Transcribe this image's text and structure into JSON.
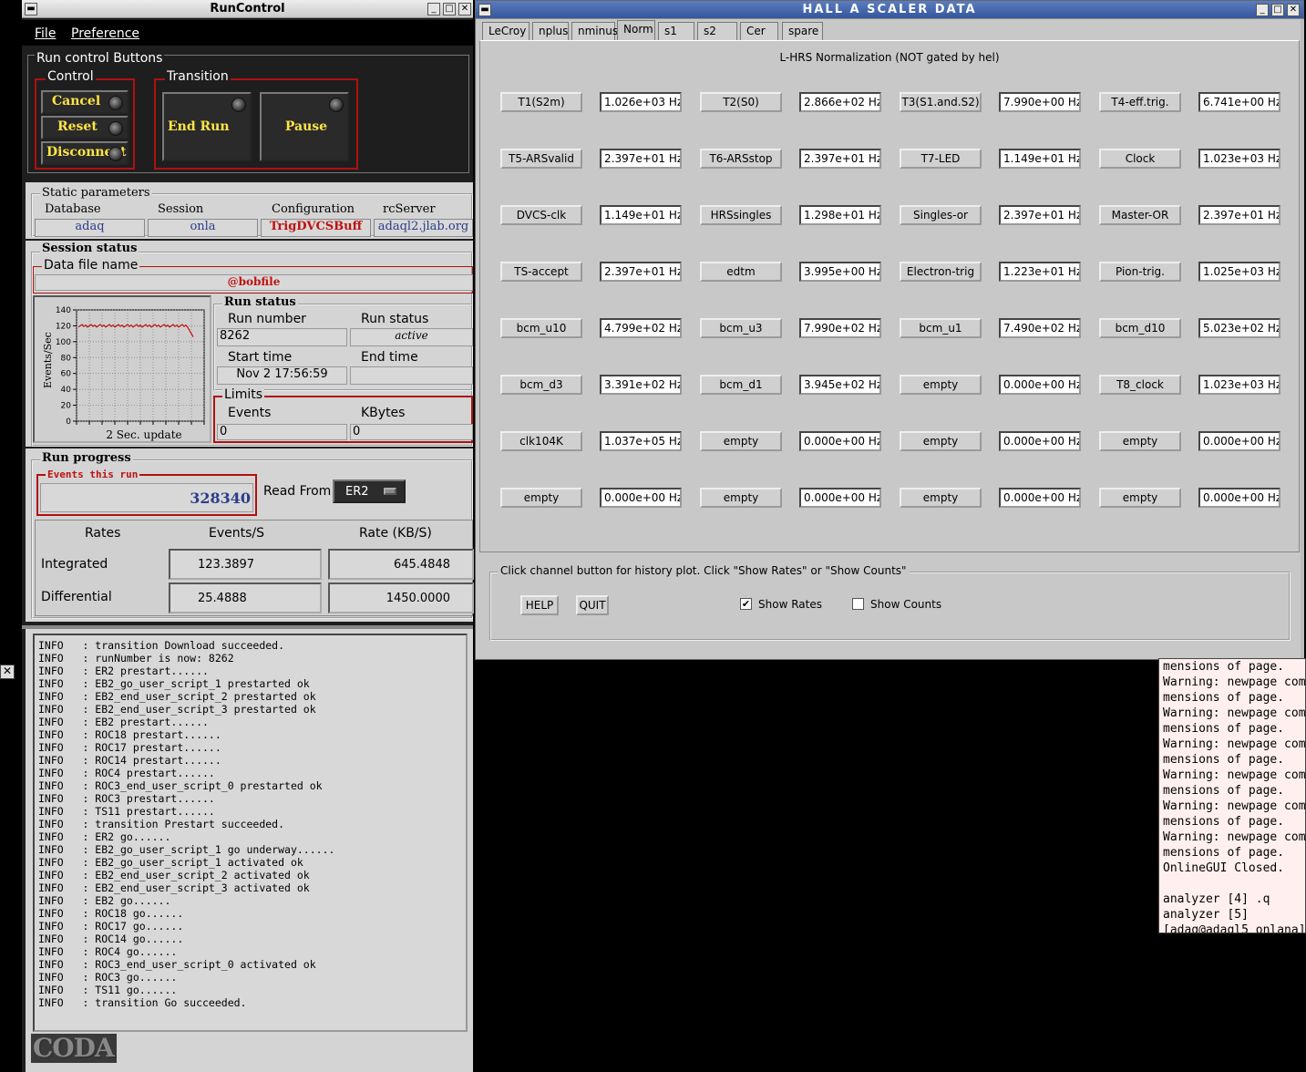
{
  "runcontrol": {
    "title": "RunControl",
    "menu": [
      "File",
      "Preference"
    ],
    "run_control_buttons_label": "Run control Buttons",
    "control_label": "Control",
    "transition_label": "Transition",
    "buttons": {
      "cancel": "Cancel",
      "reset": "Reset",
      "disconnect": "Disconnect",
      "end_run": "End Run",
      "pause": "Pause"
    },
    "static_params": {
      "label": "Static parameters",
      "database_label": "Database",
      "database": "adaq",
      "session_label": "Session",
      "session": "onla",
      "config_label": "Configuration",
      "config": "TrigDVCSBuff",
      "rcserver_label": "rcServer",
      "rcserver": "adaql2.jlab.org"
    },
    "session_status": {
      "label": "Session status",
      "datafile_label": "Data file name",
      "datafile": "@bobfile"
    },
    "plot": {
      "ylabel": "Events/Sec",
      "yticks": [
        "140",
        "120",
        "100",
        "80",
        "60",
        "40",
        "20",
        "0"
      ],
      "update_label": "2 Sec. update"
    },
    "run_status": {
      "label": "Run status",
      "run_number_label": "Run number",
      "run_number": "8262",
      "run_status_label": "Run status",
      "run_status": "active",
      "start_time_label": "Start time",
      "start_time": "Nov 2 17:56:59",
      "end_time_label": "End time",
      "end_time": ""
    },
    "limits": {
      "label": "Limits",
      "events_label": "Events",
      "events": "0",
      "kbytes_label": "KBytes",
      "kbytes": "0"
    },
    "run_progress": {
      "label": "Run progress",
      "events_label": "Events this run",
      "events": "328340",
      "read_from_label": "Read From:",
      "read_from": "ER2"
    },
    "rates": {
      "header": [
        "Rates",
        "Events/S",
        "Rate (KB/S)"
      ],
      "integrated_label": "Integrated",
      "integrated_events": "123.3897",
      "integrated_rate": "645.4848",
      "differential_label": "Differential",
      "differential_events": "25.4888",
      "differential_rate": "1450.0000"
    },
    "log": [
      "INFO   : transition Download succeeded.",
      "INFO   : runNumber is now: 8262",
      "INFO   : ER2 prestart......",
      "INFO   : EB2_go_user_script_1 prestarted ok",
      "INFO   : EB2_end_user_script_2 prestarted ok",
      "INFO   : EB2_end_user_script_3 prestarted ok",
      "INFO   : EB2 prestart......",
      "INFO   : ROC18 prestart......",
      "INFO   : ROC17 prestart......",
      "INFO   : ROC14 prestart......",
      "INFO   : ROC4 prestart......",
      "INFO   : ROC3_end_user_script_0 prestarted ok",
      "INFO   : ROC3 prestart......",
      "INFO   : TS11 prestart......",
      "INFO   : transition Prestart succeeded.",
      "INFO   : ER2 go......",
      "INFO   : EB2_go_user_script_1 go underway......",
      "INFO   : EB2_go_user_script_1 activated ok",
      "INFO   : EB2_end_user_script_2 activated ok",
      "INFO   : EB2_end_user_script_3 activated ok",
      "INFO   : EB2 go......",
      "INFO   : ROC18 go......",
      "INFO   : ROC17 go......",
      "INFO   : ROC14 go......",
      "INFO   : ROC4 go......",
      "INFO   : ROC3_end_user_script_0 activated ok",
      "INFO   : ROC3 go......",
      "INFO   : TS11 go......",
      "INFO   : transition Go succeeded."
    ],
    "logo": "CODA"
  },
  "scaler": {
    "title": "HALL A SCALER DATA",
    "tabs": [
      "LeCroy",
      "nplus",
      "nminus",
      "Norm",
      "s1",
      "s2",
      "Cer",
      "spare"
    ],
    "active_tab": "Norm",
    "heading": "L-HRS Normalization (NOT gated by hel)",
    "channels": [
      [
        {
          "name": "T1(S2m)",
          "value": "1.026e+03 Hz"
        },
        {
          "name": "T2(S0)",
          "value": "2.866e+02 Hz"
        },
        {
          "name": "T3(S1.and.S2)",
          "value": "7.990e+00 Hz"
        },
        {
          "name": "T4-eff.trig.",
          "value": "6.741e+00 Hz"
        }
      ],
      [
        {
          "name": "T5-ARSvalid",
          "value": "2.397e+01 Hz"
        },
        {
          "name": "T6-ARSstop",
          "value": "2.397e+01 Hz"
        },
        {
          "name": "T7-LED",
          "value": "1.149e+01 Hz"
        },
        {
          "name": "Clock",
          "value": "1.023e+03 Hz"
        }
      ],
      [
        {
          "name": "DVCS-clk",
          "value": "1.149e+01 Hz"
        },
        {
          "name": "HRSsingles",
          "value": "1.298e+01 Hz"
        },
        {
          "name": "Singles-or",
          "value": "2.397e+01 Hz"
        },
        {
          "name": "Master-OR",
          "value": "2.397e+01 Hz"
        }
      ],
      [
        {
          "name": "TS-accept",
          "value": "2.397e+01 Hz"
        },
        {
          "name": "edtm",
          "value": "3.995e+00 Hz"
        },
        {
          "name": "Electron-trig",
          "value": "1.223e+01 Hz"
        },
        {
          "name": "Pion-trig.",
          "value": "1.025e+03 Hz"
        }
      ],
      [
        {
          "name": "bcm_u10",
          "value": "4.799e+02 Hz"
        },
        {
          "name": "bcm_u3",
          "value": "7.990e+02 Hz"
        },
        {
          "name": "bcm_u1",
          "value": "7.490e+02 Hz"
        },
        {
          "name": "bcm_d10",
          "value": "5.023e+02 Hz"
        }
      ],
      [
        {
          "name": "bcm_d3",
          "value": "3.391e+02 Hz"
        },
        {
          "name": "bcm_d1",
          "value": "3.945e+02 Hz"
        },
        {
          "name": "empty",
          "value": "0.000e+00 Hz"
        },
        {
          "name": "T8_clock",
          "value": "1.023e+03 Hz"
        }
      ],
      [
        {
          "name": "clk104K",
          "value": "1.037e+05 Hz"
        },
        {
          "name": "empty",
          "value": "0.000e+00 Hz"
        },
        {
          "name": "empty",
          "value": "0.000e+00 Hz"
        },
        {
          "name": "empty",
          "value": "0.000e+00 Hz"
        }
      ],
      [
        {
          "name": "empty",
          "value": "0.000e+00 Hz"
        },
        {
          "name": "empty",
          "value": "0.000e+00 Hz"
        },
        {
          "name": "empty",
          "value": "0.000e+00 Hz"
        },
        {
          "name": "empty",
          "value": "0.000e+00 Hz"
        }
      ]
    ],
    "hint": "Click channel button for history plot.  Click \"Show Rates\" or \"Show Counts\"",
    "help_label": "HELP",
    "quit_label": "QUIT",
    "show_rates_label": "Show Rates",
    "show_rates_checked": true,
    "show_counts_label": "Show Counts",
    "show_counts_checked": false
  },
  "terminal": {
    "lines": [
      "mensions of page.",
      "Warning: newpage com",
      "mensions of page.",
      "Warning: newpage com",
      "mensions of page.",
      "Warning: newpage com",
      "mensions of page.",
      "Warning: newpage com",
      "mensions of page.",
      "Warning: newpage com",
      "mensions of page.",
      "Warning: newpage com",
      "mensions of page.",
      "OnlineGUI Closed.",
      "",
      "analyzer [4] .q",
      "analyzer [5]",
      "[adaq@adaql5 onlana]"
    ]
  }
}
